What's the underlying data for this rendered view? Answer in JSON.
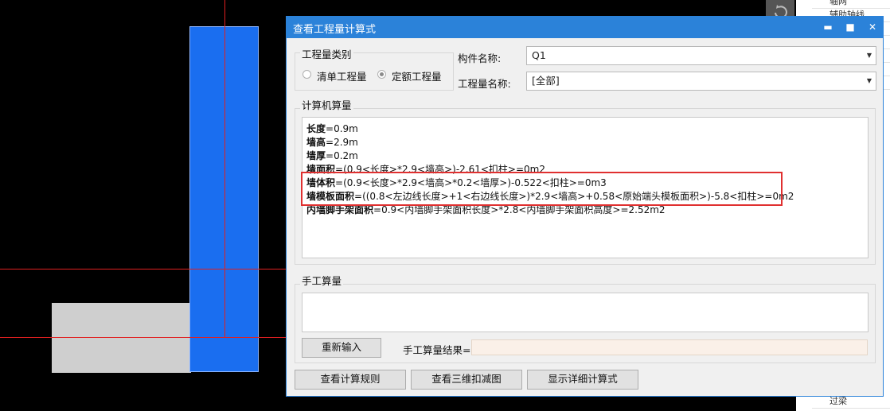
{
  "side_panel": {
    "items": [
      "轴网",
      "辅助轴线",
      "过梁"
    ]
  },
  "dialog": {
    "title": "查看工程量计算式",
    "controls": {
      "minimize": "▬",
      "maximize": "■",
      "close": "✕"
    },
    "quantity_type": {
      "group_label": "工程量类别",
      "option_list": "清单工程量",
      "option_quota": "定额工程量",
      "selected": "定额工程量"
    },
    "component_name": {
      "label": "构件名称:",
      "value": "Q1"
    },
    "quantity_name": {
      "label": "工程量名称:",
      "value": "[全部]"
    },
    "computer_calc": {
      "label": "计算机算量",
      "lines": [
        {
          "name": "长度",
          "expr": "=0.9m"
        },
        {
          "name": "墙高",
          "expr": "=2.9m"
        },
        {
          "name": "墙厚",
          "expr": "=0.2m"
        },
        {
          "name": "墙面积",
          "expr": "=(0.9<长度>*2.9<墙高>)-2.61<扣柱>=0m2"
        },
        {
          "name": "墙体积",
          "expr": "=(0.9<长度>*2.9<墙高>*0.2<墙厚>)-0.522<扣柱>=0m3"
        },
        {
          "name": "墙模板面积",
          "expr": "=((0.8<左边线长度>+1<右边线长度>)*2.9<墙高>+0.58<原始端头模板面积>)-5.8<扣柱>=0m2"
        },
        {
          "name": "内墙脚手架面积",
          "expr": "=0.9<内墙脚手架面积长度>*2.8<内墙脚手架面积高度>=2.52m2"
        }
      ]
    },
    "manual_calc": {
      "label": "手工算量",
      "reenter_button": "重新输入",
      "result_label": "手工算量结果=",
      "result_value": ""
    },
    "buttons": {
      "view_rules": "查看计算规则",
      "view_3d": "查看三维扣减图",
      "show_detail": "显示详细计算式"
    }
  },
  "colors": {
    "title_bar": "#2b82d9",
    "column_fill": "#1a6ef0",
    "highlight": "#e03030",
    "axis_line": "#e02020"
  }
}
